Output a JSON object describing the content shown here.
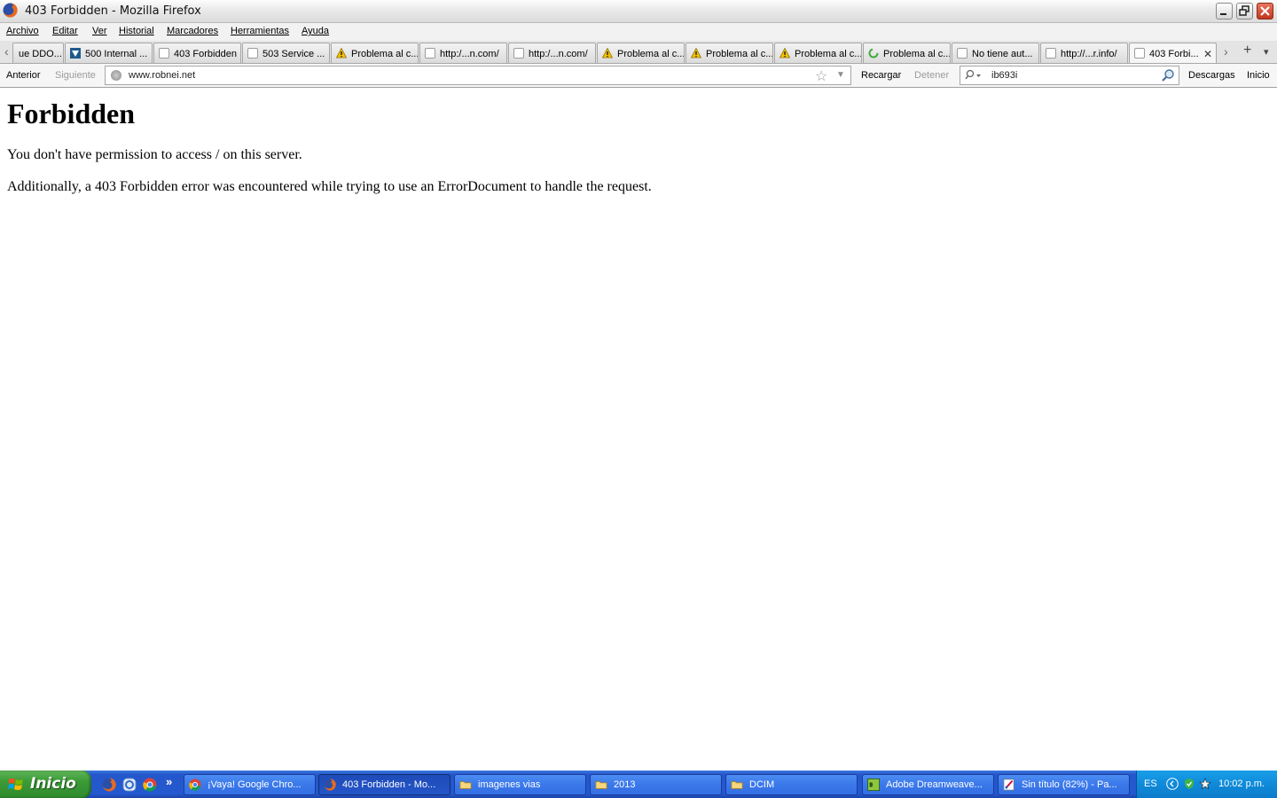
{
  "window": {
    "title": "403 Forbidden - Mozilla Firefox"
  },
  "menu": {
    "items": [
      "Archivo",
      "Editar",
      "Ver",
      "Historial",
      "Marcadores",
      "Herramientas",
      "Ayuda"
    ]
  },
  "tabs": [
    {
      "label": "ue DDO...",
      "icon": "blank-page-icon"
    },
    {
      "label": "500 Internal ...",
      "icon": "site-logo-icon"
    },
    {
      "label": "403 Forbidden",
      "icon": "blank-page-icon"
    },
    {
      "label": "503 Service ...",
      "icon": "blank-page-icon"
    },
    {
      "label": "Problema al c...",
      "icon": "warning-icon"
    },
    {
      "label": "http:/...n.com/",
      "icon": "blank-page-icon"
    },
    {
      "label": "http:/...n.com/",
      "icon": "blank-page-icon"
    },
    {
      "label": "Problema al c...",
      "icon": "warning-icon"
    },
    {
      "label": "Problema al c...",
      "icon": "warning-icon"
    },
    {
      "label": "Problema al c...",
      "icon": "warning-icon"
    },
    {
      "label": "Problema al c...",
      "icon": "loading-icon"
    },
    {
      "label": "No tiene aut...",
      "icon": "blank-page-icon"
    },
    {
      "label": "http://...r.info/",
      "icon": "blank-page-icon"
    },
    {
      "label": "403 Forbi...",
      "icon": "blank-page-icon",
      "active": true
    }
  ],
  "tabstrip": {
    "close_glyph": "✕",
    "new_tab_glyph": "+",
    "scroll_left_glyph": "‹",
    "scroll_right_glyph": "›",
    "list_glyph": "▾"
  },
  "navbar": {
    "back": "Anterior",
    "forward": "Siguiente",
    "url": "www.robnei.net",
    "reload": "Recargar",
    "stop": "Detener",
    "search_value": "ib693i",
    "downloads": "Descargas",
    "home": "Inicio"
  },
  "page": {
    "heading": "Forbidden",
    "line1": "You don't have permission to access / on this server.",
    "line2": "Additionally, a 403 Forbidden error was encountered while trying to use an ErrorDocument to handle the request."
  },
  "taskbar": {
    "start": "Inicio",
    "more_glyph": "»",
    "tasks": [
      {
        "label": "¡Vaya! Google Chro...",
        "icon": "chrome-icon"
      },
      {
        "label": "403 Forbidden - Mo...",
        "icon": "firefox-icon",
        "active": true
      },
      {
        "label": "imagenes vias",
        "icon": "folder-icon"
      },
      {
        "label": "2013",
        "icon": "folder-icon"
      },
      {
        "label": "DCIM",
        "icon": "folder-icon"
      },
      {
        "label": "Adobe Dreamweave...",
        "icon": "dreamweaver-icon"
      },
      {
        "label": "Sin título (82%) - Pa...",
        "icon": "paint-icon"
      }
    ],
    "lang": "ES",
    "clock": "10:02 p.m."
  },
  "colors": {
    "taskbar_blue": "#2458ce",
    "start_green": "#3c9a37",
    "tray_blue": "#0f8ad9",
    "warning_yellow": "#f4c400"
  }
}
